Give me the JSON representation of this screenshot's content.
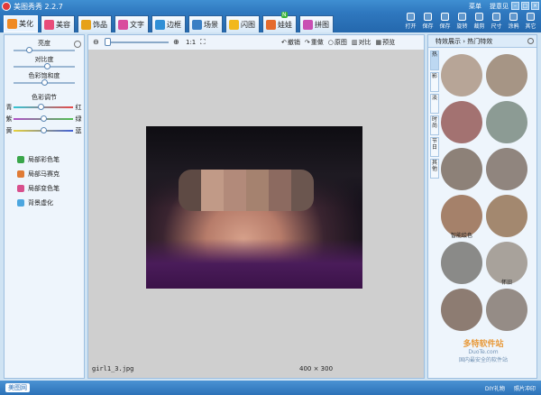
{
  "window": {
    "title": "美图秀秀 2.2.7",
    "links": [
      "菜单",
      "提意见"
    ],
    "buttons": [
      "–",
      "□",
      "×"
    ]
  },
  "tabs": [
    {
      "label": "美化",
      "icon": "beautify-icon",
      "color": "#f08a24",
      "active": true
    },
    {
      "label": "美容",
      "icon": "cosmetic-icon",
      "color": "#e84c7a",
      "active": false
    },
    {
      "label": "饰品",
      "icon": "accessory-icon",
      "color": "#e6a11a",
      "active": false
    },
    {
      "label": "文字",
      "icon": "text-icon",
      "color": "#d94b9e",
      "active": false
    },
    {
      "label": "边框",
      "icon": "frame-icon",
      "color": "#2f8fd6",
      "active": false
    },
    {
      "label": "场景",
      "icon": "scene-icon",
      "color": "#3a7fc4",
      "active": false
    },
    {
      "label": "闪图",
      "icon": "flash-icon",
      "color": "#f2b81c",
      "active": false
    },
    {
      "label": "娃娃",
      "icon": "doll-icon",
      "color": "#e56b2e",
      "active": false
    },
    {
      "label": "拼图",
      "icon": "puzzle-icon",
      "color": "#c94fb3",
      "active": false
    }
  ],
  "tab_badge": "N",
  "actions": [
    {
      "label": "打开",
      "icon": "open-icon"
    },
    {
      "label": "保存",
      "icon": "save-icon"
    },
    {
      "label": "保存",
      "icon": "save-as-icon"
    },
    {
      "label": "旋转",
      "icon": "rotate-icon"
    },
    {
      "label": "裁剪",
      "icon": "crop-icon"
    },
    {
      "label": "尺寸",
      "icon": "resize-icon"
    },
    {
      "label": "涂鸦",
      "icon": "doodle-icon"
    },
    {
      "label": "其它",
      "icon": "other-icon"
    }
  ],
  "left": {
    "sliders": [
      {
        "label": "亮度",
        "value": 0.25
      },
      {
        "label": "对比度",
        "value": 0.55
      },
      {
        "label": "色彩饱和度",
        "value": 0.5
      }
    ],
    "color_title": "色彩调节",
    "color_rows": [
      {
        "left": "青",
        "right": "红",
        "value": 0.45,
        "from": "#33c7d6",
        "to": "#e84848"
      },
      {
        "left": "紫",
        "right": "绿",
        "value": 0.5,
        "from": "#b04fc8",
        "to": "#4fc04f"
      },
      {
        "left": "黄",
        "right": "蓝",
        "value": 0.5,
        "from": "#e8d23a",
        "to": "#4060d8"
      }
    ],
    "tools": [
      {
        "label": "局部彩色笔",
        "icon": "color-pen-icon",
        "color": "#3aa64a"
      },
      {
        "label": "局部马赛克",
        "icon": "mosaic-icon",
        "color": "#e07b35"
      },
      {
        "label": "局部变色笔",
        "icon": "recolor-pen-icon",
        "color": "#d8508d"
      },
      {
        "label": "背景虚化",
        "icon": "blur-icon",
        "color": "#4ca6df"
      }
    ]
  },
  "canvas": {
    "zoom_label": "1:1",
    "actions": [
      {
        "label": "撤销",
        "icon": "undo-icon"
      },
      {
        "label": "重做",
        "icon": "redo-icon"
      },
      {
        "label": "原图",
        "icon": "original-icon"
      },
      {
        "label": "对比",
        "icon": "compare-icon"
      },
      {
        "label": "预览",
        "icon": "preview-icon"
      }
    ],
    "filename": "girl1_3.jpg",
    "dimensions": "400 × 300",
    "mosaic_colors": [
      "#5e4a44",
      "#c19a87",
      "#b28a7a",
      "#a5826f",
      "#8c6a60",
      "#6b564f"
    ]
  },
  "right": {
    "header": "特效展示 › 热门特效",
    "vtabs": [
      "热",
      "影",
      "淡",
      "时尚",
      "节日",
      "其他"
    ],
    "thumbs": [
      {
        "label": "",
        "color": "#b7a597"
      },
      {
        "label": "",
        "color": "#a69585"
      },
      {
        "label": "",
        "color": "#a37271"
      },
      {
        "label": "",
        "color": "#8c9b94"
      },
      {
        "label": "",
        "color": "#8d8178"
      },
      {
        "label": "",
        "color": "#90857e"
      },
      {
        "label": "智能绘色",
        "color": "#a5816a"
      },
      {
        "label": "",
        "color": "#a3886f"
      },
      {
        "label": "",
        "color": "#8a8a88"
      },
      {
        "label": "怀旧",
        "color": "#a8a29b"
      },
      {
        "label": "",
        "color": "#8d7c72"
      },
      {
        "label": "",
        "color": "#958c86"
      }
    ]
  },
  "status": {
    "home": "美图网",
    "items": [
      "DIY礼物",
      "照片冲印"
    ]
  },
  "watermark": {
    "main": "多特软件站",
    "site": "DuoTe.com",
    "sub": "国内最安全的软件站"
  }
}
